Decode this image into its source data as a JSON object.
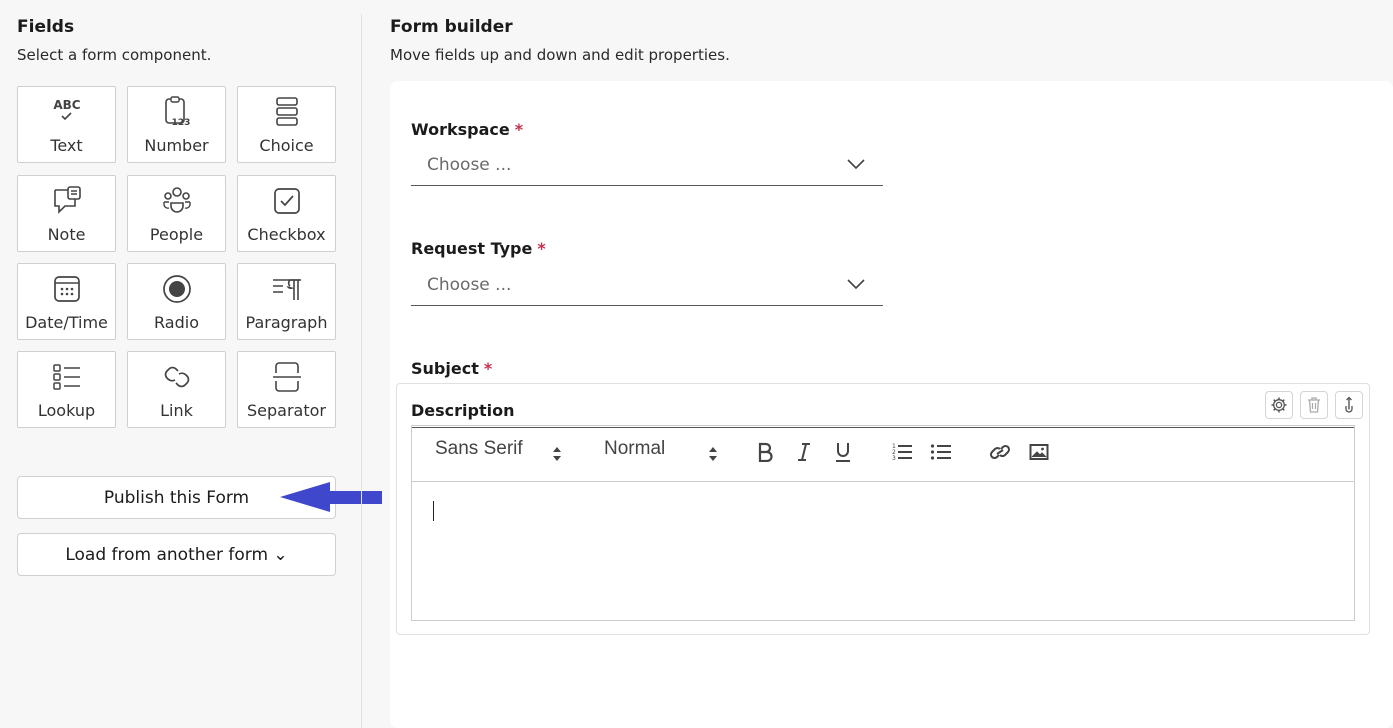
{
  "fields_panel": {
    "title": "Fields",
    "subtitle": "Select a form component.",
    "tiles": [
      {
        "label": "Text",
        "icon": "text-abc-icon"
      },
      {
        "label": "Number",
        "icon": "clipboard-number-icon"
      },
      {
        "label": "Choice",
        "icon": "choice-list-icon"
      },
      {
        "label": "Note",
        "icon": "note-comment-icon"
      },
      {
        "label": "People",
        "icon": "people-icon"
      },
      {
        "label": "Checkbox",
        "icon": "checkbox-icon"
      },
      {
        "label": "Date/Time",
        "icon": "calendar-icon"
      },
      {
        "label": "Radio",
        "icon": "radio-icon"
      },
      {
        "label": "Paragraph",
        "icon": "paragraph-icon"
      },
      {
        "label": "Lookup",
        "icon": "lookup-list-icon"
      },
      {
        "label": "Link",
        "icon": "link-icon"
      },
      {
        "label": "Separator",
        "icon": "separator-icon"
      }
    ],
    "publish_label": "Publish this Form",
    "load_label": "Load from another form ⌄"
  },
  "builder": {
    "title": "Form builder",
    "subtitle": "Move fields up and down and edit properties.",
    "required_mark": "*",
    "workspace": {
      "label": "Workspace",
      "value": "Choose ..."
    },
    "request_type": {
      "label": "Request Type",
      "value": "Choose ..."
    },
    "subject": {
      "label": "Subject",
      "value": ""
    },
    "description": {
      "label": "Description",
      "toolbar": {
        "font": "Sans Serif",
        "size": "Normal"
      }
    }
  },
  "colors": {
    "required": "#c4314b",
    "arrow": "#3f48cc",
    "background": "#f7f7f7"
  }
}
